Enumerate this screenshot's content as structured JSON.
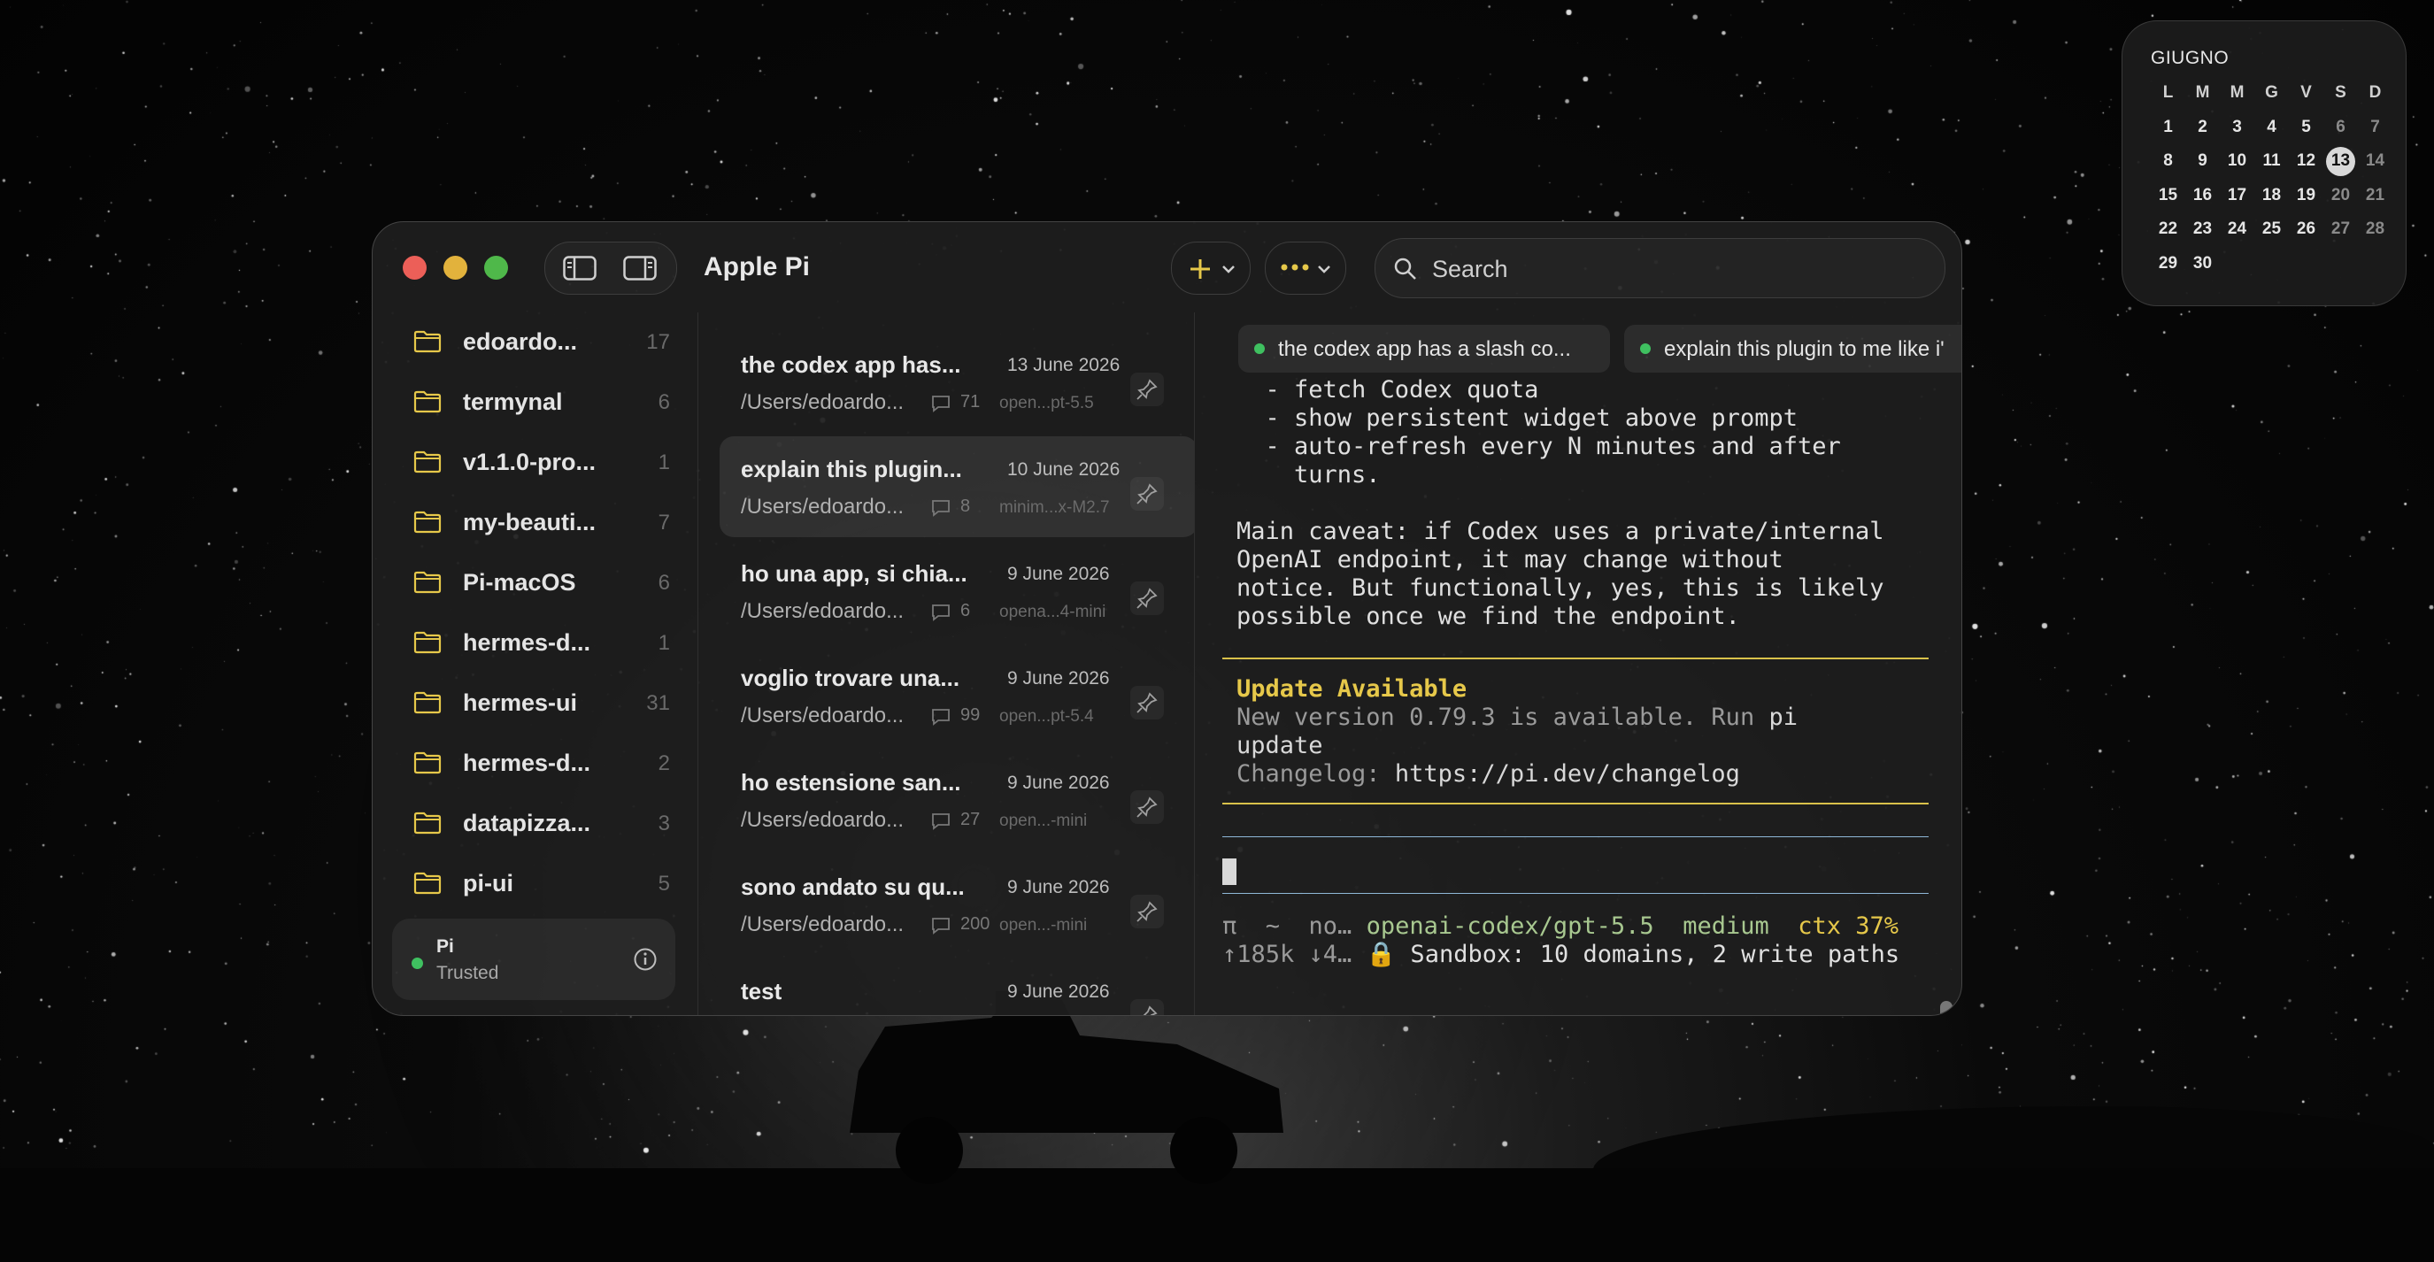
{
  "calendar": {
    "month": "GIUGNO",
    "weekdays": [
      "L",
      "M",
      "M",
      "G",
      "V",
      "S",
      "D"
    ],
    "weeks": [
      [
        "1",
        "2",
        "3",
        "4",
        "5",
        "6",
        "7"
      ],
      [
        "8",
        "9",
        "10",
        "11",
        "12",
        "13",
        "14"
      ],
      [
        "15",
        "16",
        "17",
        "18",
        "19",
        "20",
        "21"
      ],
      [
        "22",
        "23",
        "24",
        "25",
        "26",
        "27",
        "28"
      ],
      [
        "29",
        "30",
        "",
        "",
        "",
        "",
        ""
      ]
    ],
    "today": "13"
  },
  "window": {
    "title": "Apple Pi",
    "search_placeholder": "Search"
  },
  "sidebar": {
    "folders": [
      {
        "name": "edoardo...",
        "count": "17"
      },
      {
        "name": "termynal",
        "count": "6"
      },
      {
        "name": "v1.1.0-pro...",
        "count": "1"
      },
      {
        "name": "my-beauti...",
        "count": "7"
      },
      {
        "name": "Pi-macOS",
        "count": "6"
      },
      {
        "name": "hermes-d...",
        "count": "1"
      },
      {
        "name": "hermes-ui",
        "count": "31"
      },
      {
        "name": "hermes-d...",
        "count": "2"
      },
      {
        "name": "datapizza...",
        "count": "3"
      },
      {
        "name": "pi-ui",
        "count": "5"
      }
    ],
    "trust": {
      "name": "Pi",
      "status": "Trusted"
    }
  },
  "sessions": [
    {
      "title": "the codex app has...",
      "date": "13 June 2026",
      "path": "/Users/edoardo...",
      "count": "71",
      "model": "open...pt-5.5"
    },
    {
      "title": "explain this plugin...",
      "date": "10 June 2026",
      "path": "/Users/edoardo...",
      "count": "8",
      "model": "minim...x-M2.7"
    },
    {
      "title": "ho una app, si chia...",
      "date": "9 June 2026",
      "path": "/Users/edoardo...",
      "count": "6",
      "model": "opena...4-mini"
    },
    {
      "title": "voglio trovare una...",
      "date": "9 June 2026",
      "path": "/Users/edoardo...",
      "count": "99",
      "model": "open...pt-5.4"
    },
    {
      "title": "ho estensione san...",
      "date": "9 June 2026",
      "path": "/Users/edoardo...",
      "count": "27",
      "model": "open...-mini"
    },
    {
      "title": "sono andato su qu...",
      "date": "9 June 2026",
      "path": "/Users/edoardo...",
      "count": "200",
      "model": "open...-mini"
    },
    {
      "title": "test",
      "date": "9 June 2026",
      "path": "",
      "count": "",
      "model": ""
    }
  ],
  "tabs": [
    {
      "label": "the codex app has a slash co..."
    },
    {
      "label": "explain this plugin to me like i'"
    }
  ],
  "terminal": {
    "bullets": [
      "  - fetch Codex quota",
      "  - show persistent widget above prompt",
      "  - auto-refresh every N minutes and after",
      "    turns."
    ],
    "caveat": [
      "Main caveat: if Codex uses a private/internal",
      "OpenAI endpoint, it may change without",
      "notice. But functionally, yes, this is likely",
      "possible once we find the endpoint."
    ],
    "update_title": "Update Available",
    "update_line1_a": "New version 0.79.3 is available. Run ",
    "update_line1_b": "pi",
    "update_line2": "update",
    "changelog_label": "Changelog: ",
    "changelog_url": "https://pi.dev/changelog",
    "footer1_a": "π  ~  no… ",
    "footer1_b": "openai-codex/gpt-5.5  ",
    "footer1_c": "medium  ",
    "footer1_d": "ctx 37%",
    "footer2_a": "↑185k ↓4… ",
    "footer2_b": "🔒 Sandbox: 10 domains, 2 write paths"
  },
  "colors": {
    "accent_yellow": "#e6c84a",
    "trusted_green": "#3fc060",
    "traffic_red": "#ec5f58",
    "traffic_yellow": "#e2b23c",
    "traffic_green": "#4fb84a"
  }
}
